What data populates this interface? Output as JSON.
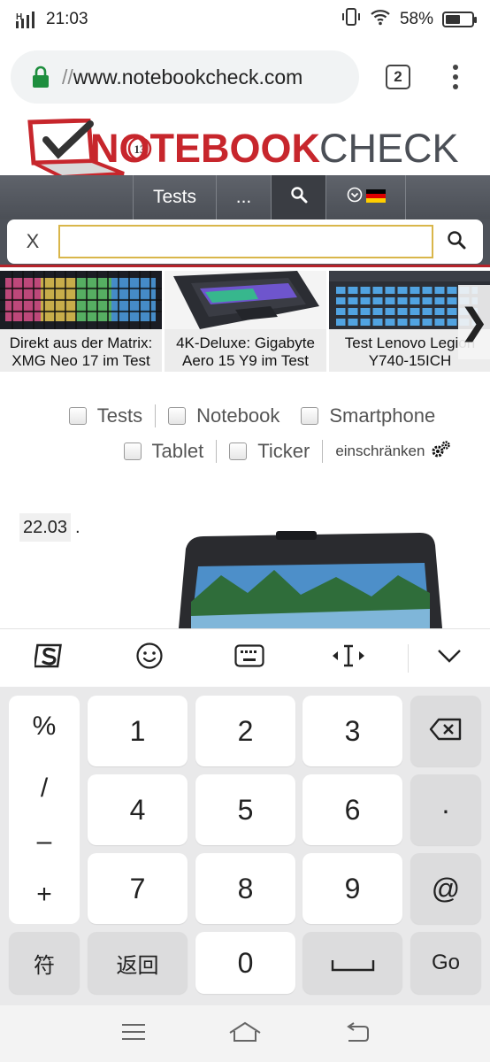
{
  "status_bar": {
    "time": "21:03",
    "battery_percent": "58%",
    "battery_level": 0.58
  },
  "browser": {
    "url_prefix": "//",
    "url_host": "www.notebookcheck.com",
    "tab_count": "2"
  },
  "site": {
    "logo_text_red": "NOTEBOOK",
    "logo_text_dark": "CHECK",
    "logo_badge": "13",
    "nav": {
      "tests_label": "Tests",
      "more_label": "..."
    },
    "search": {
      "close_label": "X",
      "value": ""
    }
  },
  "carousel": {
    "items": [
      {
        "caption_line1": "Direkt aus der Matrix:",
        "caption_line2": "XMG Neo 17 im Test"
      },
      {
        "caption_line1": "4K-Deluxe: Gigabyte",
        "caption_line2": "Aero 15 Y9 im Test"
      },
      {
        "caption_line1": "Test Lenovo Legion",
        "caption_line2": "Y740-15ICH"
      }
    ],
    "next_label": "❯"
  },
  "filters": {
    "tests": "Tests",
    "notebook": "Notebook",
    "smartphone": "Smartphone",
    "tablet": "Tablet",
    "ticker": "Ticker",
    "restrict": "einschränken"
  },
  "article": {
    "date": "22.03",
    "date_suffix": "."
  },
  "keyboard": {
    "symbols": [
      "%",
      "/",
      "–",
      "+"
    ],
    "digits": [
      "1",
      "2",
      "3",
      "4",
      "5",
      "6",
      "7",
      "8",
      "9",
      "0"
    ],
    "dot": "·",
    "at": "@",
    "sym_label": "符",
    "back_label": "返回",
    "go_label": "Go"
  }
}
